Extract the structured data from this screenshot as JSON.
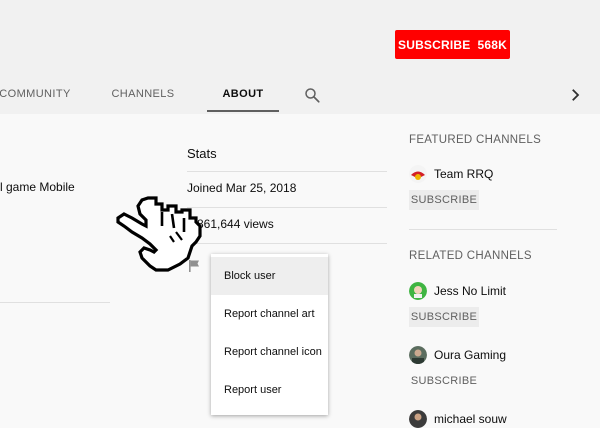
{
  "header": {
    "subscribe_label": "SUBSCRIBE",
    "subscriber_count": "568K"
  },
  "tabs": [
    {
      "label": "COMMUNITY",
      "active": false
    },
    {
      "label": "CHANNELS",
      "active": false
    },
    {
      "label": "ABOUT",
      "active": true
    }
  ],
  "icons": {
    "search": "search-icon",
    "next": "chevron-right-icon",
    "flag": "flag-icon",
    "cursor": "hand-pointer-cursor"
  },
  "about": {
    "description_fragment": "l game Mobile",
    "stats_title": "Stats",
    "joined": "Joined Mar 25, 2018",
    "views": "0,861,644 views"
  },
  "menu": {
    "items": [
      "Block user",
      "Report channel art",
      "Report channel icon",
      "Report user"
    ],
    "highlighted_index": 0
  },
  "sidebar": {
    "featured_heading": "FEATURED CHANNELS",
    "related_heading": "RELATED CHANNELS",
    "subscribe_label": "SUBSCRIBE",
    "featured": [
      {
        "name": "Team RRQ"
      }
    ],
    "related": [
      {
        "name": "Jess No Limit"
      },
      {
        "name": "Oura Gaming"
      },
      {
        "name": "michael souw"
      }
    ]
  },
  "colors": {
    "subscribe_bg": "#ff0000",
    "header_bg": "#f1f1f1",
    "page_bg": "#f9f9f9",
    "menu_hover": "#eeeeee"
  }
}
